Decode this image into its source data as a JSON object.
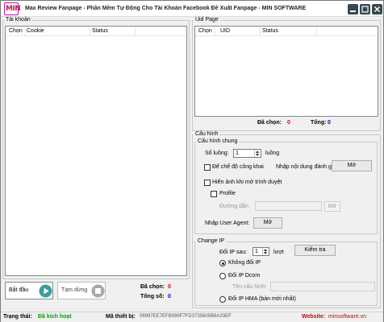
{
  "window": {
    "title": "Max Review Fanpage - Phần Mềm Tự Động Cho Tài Khoản Facebook Đề Xuất Fanpage - MIN SOFTWARE",
    "logo_text": "MIN",
    "logo_icon": "min-software-logo",
    "controls": [
      "minimize-icon",
      "maximize-icon",
      "close-icon"
    ]
  },
  "accounts": {
    "group_title": "Tài khoản",
    "columns": [
      "Chọn",
      "Cookie",
      "Status"
    ]
  },
  "uid_page": {
    "group_title": "Uid Page",
    "columns": [
      "Chọn",
      "UID",
      "Status"
    ],
    "selected_label": "Đã chọn:",
    "selected_value": "0",
    "total_label": "Tổng:",
    "total_value": "0"
  },
  "config": {
    "group_title": "Cấu hình",
    "general": {
      "title": "Cấu hình chung",
      "thread_label": "Số luồng:",
      "thread_value": "1",
      "thread_unit": "luồng",
      "public_mode_label": "Để chế độ công khai",
      "review_content_label": "Nhập nội dung đánh giá:",
      "review_open_button": "Mở",
      "show_browser_label": "Hiển ảnh khi mở trình duyệt",
      "profile_label": "Profile",
      "path_label": "Đường dẫn:",
      "path_value": "",
      "path_open_button": "Mở",
      "user_agent_label": "Nhập User Agent:",
      "user_agent_button": "Mở"
    },
    "change_ip": {
      "title": "Change IP",
      "change_after_label": "Đổi IP sau:",
      "change_after_value": "1",
      "change_after_unit": "lượt",
      "check_button": "Kiểm tra",
      "options": [
        {
          "label": "Không đổi IP",
          "checked": true
        },
        {
          "label": "Đổi IP Dcom",
          "checked": false
        },
        {
          "label": "Đổi IP HMA (bản mới nhất)",
          "checked": false
        }
      ],
      "dcom_name_label": "Tên cấu hình:",
      "dcom_name_value": ""
    }
  },
  "actions": {
    "start_label": "Bắt đầu",
    "start_icon": "play-icon",
    "stop_label": "Tạm dừng",
    "stop_icon": "stop-icon",
    "selected_label": "Đã chọn:",
    "selected_value": "0",
    "total_label": "Tổng số:",
    "total_value": "0"
  },
  "status_bar": {
    "status_label": "Trạng thái:",
    "status_value": "Đã kích hoạt",
    "device_label": "Mã thiết bị:",
    "device_value": "08997EE7EFB099F7FD3735605B6A33EF",
    "website_label": "Website:",
    "website_value": "minsoftware.vn"
  },
  "colors": {
    "accent_red": "#e00000",
    "accent_blue": "#0000cc",
    "accent_green": "#00a000",
    "play_teal": "#3a9e9a",
    "logo_magenta": "#c2185b"
  }
}
